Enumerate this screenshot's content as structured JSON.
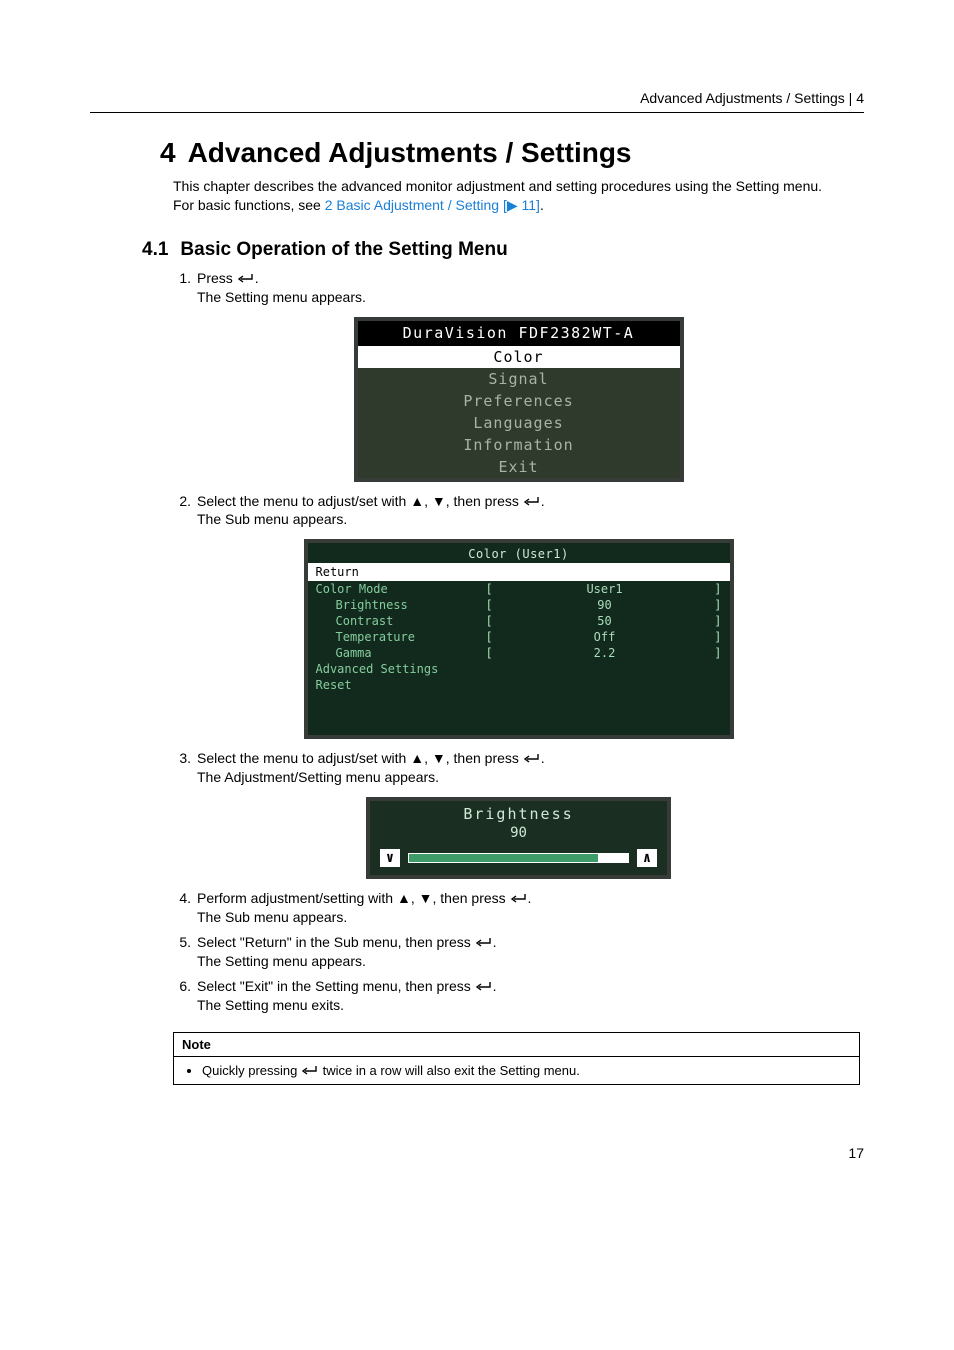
{
  "header": {
    "section_title": "Advanced Adjustments / Settings",
    "section_number": "4"
  },
  "title": {
    "number": "4",
    "text": "Advanced Adjustments / Settings"
  },
  "intro": {
    "line1": "This chapter describes the advanced monitor adjustment and setting procedures using the Setting menu.",
    "line2_prefix": "For basic functions, see ",
    "line2_link": "2 Basic Adjustment / Setting [",
    "line2_xref": "▶ 11]",
    "line2_suffix": "."
  },
  "subsection": {
    "number": "4.1",
    "text": "Basic Operation of the Setting Menu"
  },
  "steps": {
    "s1": {
      "num": "1.",
      "a": "Press ",
      "b": ".",
      "c": "The Setting menu appears."
    },
    "s2": {
      "num": "2.",
      "a": "Select the menu to adjust/set with ",
      "tri": "▲, ▼",
      "b": ", then press ",
      "c": ".",
      "d": "The Sub menu appears."
    },
    "s3": {
      "num": "3.",
      "a": "Select the menu to adjust/set with ",
      "tri": "▲, ▼",
      "b": ", then press ",
      "c": ".",
      "d": "The Adjustment/Setting menu appears."
    },
    "s4": {
      "num": "4.",
      "a": "Perform adjustment/setting with ",
      "tri": "▲, ▼",
      "b": ", then press ",
      "c": ".",
      "d": "The Sub menu appears."
    },
    "s5": {
      "num": "5.",
      "a": "Select \"Return\" in the Sub menu, then press ",
      "b": ".",
      "c": "The Setting menu appears."
    },
    "s6": {
      "num": "6.",
      "a": "Select \"Exit\" in the Setting menu, then press ",
      "b": ".",
      "c": "The Setting menu exits."
    }
  },
  "osd_main": {
    "title": "DuraVision FDF2382WT-A",
    "items": [
      "Color",
      "Signal",
      "Preferences",
      "Languages",
      "Information",
      "Exit"
    ]
  },
  "osd_sub": {
    "title": "Color (User1)",
    "return_label": "Return",
    "rows": [
      {
        "label": "Color Mode",
        "value": "User1",
        "indent": false,
        "bracket": true
      },
      {
        "label": "Brightness",
        "value": "90",
        "indent": true,
        "bracket": true
      },
      {
        "label": "Contrast",
        "value": "50",
        "indent": true,
        "bracket": true
      },
      {
        "label": "Temperature",
        "value": "Off",
        "indent": true,
        "bracket": true
      },
      {
        "label": "Gamma",
        "value": "2.2",
        "indent": true,
        "bracket": true
      },
      {
        "label": "Advanced Settings",
        "value": "",
        "indent": false,
        "bracket": false
      },
      {
        "label": "Reset",
        "value": "",
        "indent": false,
        "bracket": false
      }
    ]
  },
  "osd_adjust": {
    "title": "Brightness",
    "value": "90",
    "left": "∨",
    "right": "∧"
  },
  "note": {
    "head": "Note",
    "body_a": "Quickly pressing ",
    "body_b": " twice in a row will also exit the Setting menu."
  },
  "page_number": "17"
}
